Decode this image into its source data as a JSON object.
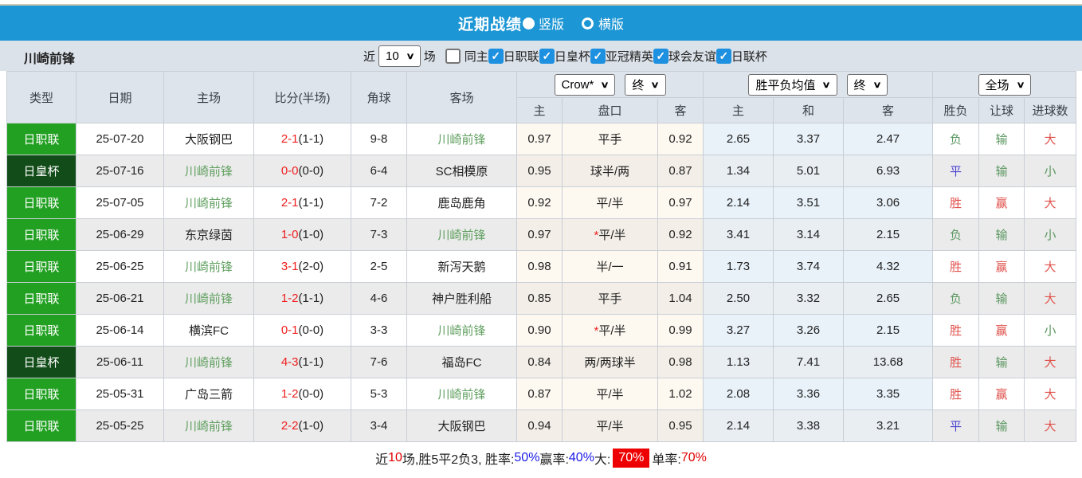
{
  "title_bar": {
    "title": "近期战绩",
    "radios": [
      {
        "label": "竖版",
        "selected": true
      },
      {
        "label": "横版",
        "selected": false
      }
    ]
  },
  "filter_bar": {
    "team": "川崎前锋",
    "near_label": "近",
    "near_value": "10",
    "games_label": "场",
    "checkboxes": [
      {
        "label": "同主",
        "checked": false
      },
      {
        "label": "日职联",
        "checked": true
      },
      {
        "label": "日皇杯",
        "checked": true
      },
      {
        "label": "亚冠精英",
        "checked": true
      },
      {
        "label": "球会友谊",
        "checked": true
      },
      {
        "label": "日联杯",
        "checked": true
      }
    ],
    "check_glyph": "✓"
  },
  "table": {
    "headers": [
      "类型",
      "日期",
      "主场",
      "比分(半场)",
      "角球",
      "客场"
    ],
    "sub_headers": [
      "主",
      "盘口",
      "客",
      "主",
      "和",
      "客",
      "胜负",
      "让球",
      "进球数"
    ],
    "selects": {
      "bookmaker": "Crow*",
      "bookmaker_time": "终",
      "odds_type": "胜平负均值",
      "odds_time": "终",
      "scope": "全场"
    },
    "arrow_glyph": "∨",
    "rows": [
      {
        "type": "日职联",
        "type_style": "league",
        "date": "25-07-20",
        "home": "大阪钢巴",
        "home_hl": false,
        "score": "2-1",
        "half": "(1-1)",
        "corner": "9-8",
        "away": "川崎前锋",
        "away_hl": true,
        "let_home": "0.97",
        "handicap": "平手",
        "handicap_star": false,
        "let_away": "0.92",
        "avg_home": "2.65",
        "avg_draw": "3.37",
        "avg_away": "2.47",
        "wdl": "负",
        "wdl_c": "green",
        "let_res": "输",
        "let_c": "green",
        "goals": "大",
        "goals_c": "red"
      },
      {
        "type": "日皇杯",
        "type_style": "cup",
        "date": "25-07-16",
        "home": "川崎前锋",
        "home_hl": true,
        "score": "0-0",
        "half": "(0-0)",
        "corner": "6-4",
        "away": "SC相模原",
        "away_hl": false,
        "let_home": "0.95",
        "handicap": "球半/两",
        "handicap_star": false,
        "let_away": "0.87",
        "avg_home": "1.34",
        "avg_draw": "5.01",
        "avg_away": "6.93",
        "wdl": "平",
        "wdl_c": "blue",
        "let_res": "输",
        "let_c": "green",
        "goals": "小",
        "goals_c": "green"
      },
      {
        "type": "日职联",
        "type_style": "league",
        "date": "25-07-05",
        "home": "川崎前锋",
        "home_hl": true,
        "score": "2-1",
        "half": "(1-1)",
        "corner": "7-2",
        "away": "鹿岛鹿角",
        "away_hl": false,
        "let_home": "0.92",
        "handicap": "平/半",
        "handicap_star": false,
        "let_away": "0.97",
        "avg_home": "2.14",
        "avg_draw": "3.51",
        "avg_away": "3.06",
        "wdl": "胜",
        "wdl_c": "red",
        "let_res": "赢",
        "let_c": "red",
        "goals": "大",
        "goals_c": "red"
      },
      {
        "type": "日职联",
        "type_style": "league",
        "date": "25-06-29",
        "home": "东京绿茵",
        "home_hl": false,
        "score": "1-0",
        "half": "(1-0)",
        "corner": "7-3",
        "away": "川崎前锋",
        "away_hl": true,
        "let_home": "0.97",
        "handicap": "平/半",
        "handicap_star": true,
        "let_away": "0.92",
        "avg_home": "3.41",
        "avg_draw": "3.14",
        "avg_away": "2.15",
        "wdl": "负",
        "wdl_c": "green",
        "let_res": "输",
        "let_c": "green",
        "goals": "小",
        "goals_c": "green"
      },
      {
        "type": "日职联",
        "type_style": "league",
        "date": "25-06-25",
        "home": "川崎前锋",
        "home_hl": true,
        "score": "3-1",
        "half": "(2-0)",
        "corner": "2-5",
        "away": "新泻天鹅",
        "away_hl": false,
        "let_home": "0.98",
        "handicap": "半/一",
        "handicap_star": false,
        "let_away": "0.91",
        "avg_home": "1.73",
        "avg_draw": "3.74",
        "avg_away": "4.32",
        "wdl": "胜",
        "wdl_c": "red",
        "let_res": "赢",
        "let_c": "red",
        "goals": "大",
        "goals_c": "red"
      },
      {
        "type": "日职联",
        "type_style": "league",
        "date": "25-06-21",
        "home": "川崎前锋",
        "home_hl": true,
        "score": "1-2",
        "half": "(1-1)",
        "corner": "4-6",
        "away": "神户胜利船",
        "away_hl": false,
        "let_home": "0.85",
        "handicap": "平手",
        "handicap_star": false,
        "let_away": "1.04",
        "avg_home": "2.50",
        "avg_draw": "3.32",
        "avg_away": "2.65",
        "wdl": "负",
        "wdl_c": "green",
        "let_res": "输",
        "let_c": "green",
        "goals": "大",
        "goals_c": "red"
      },
      {
        "type": "日职联",
        "type_style": "league",
        "date": "25-06-14",
        "home": "横滨FC",
        "home_hl": false,
        "score": "0-1",
        "half": "(0-0)",
        "corner": "3-3",
        "away": "川崎前锋",
        "away_hl": true,
        "let_home": "0.90",
        "handicap": "平/半",
        "handicap_star": true,
        "let_away": "0.99",
        "avg_home": "3.27",
        "avg_draw": "3.26",
        "avg_away": "2.15",
        "wdl": "胜",
        "wdl_c": "red",
        "let_res": "赢",
        "let_c": "red",
        "goals": "小",
        "goals_c": "green"
      },
      {
        "type": "日皇杯",
        "type_style": "cup",
        "date": "25-06-11",
        "home": "川崎前锋",
        "home_hl": true,
        "score": "4-3",
        "half": "(1-1)",
        "corner": "7-6",
        "away": "福岛FC",
        "away_hl": false,
        "let_home": "0.84",
        "handicap": "两/两球半",
        "handicap_star": false,
        "let_away": "0.98",
        "avg_home": "1.13",
        "avg_draw": "7.41",
        "avg_away": "13.68",
        "wdl": "胜",
        "wdl_c": "red",
        "let_res": "输",
        "let_c": "green",
        "goals": "大",
        "goals_c": "red"
      },
      {
        "type": "日职联",
        "type_style": "league",
        "date": "25-05-31",
        "home": "广岛三箭",
        "home_hl": false,
        "score": "1-2",
        "half": "(0-0)",
        "corner": "5-3",
        "away": "川崎前锋",
        "away_hl": true,
        "let_home": "0.87",
        "handicap": "平/半",
        "handicap_star": false,
        "let_away": "1.02",
        "avg_home": "2.08",
        "avg_draw": "3.36",
        "avg_away": "3.35",
        "wdl": "胜",
        "wdl_c": "red",
        "let_res": "赢",
        "let_c": "red",
        "goals": "大",
        "goals_c": "red"
      },
      {
        "type": "日职联",
        "type_style": "league",
        "date": "25-05-25",
        "home": "川崎前锋",
        "home_hl": true,
        "score": "2-2",
        "half": "(1-0)",
        "corner": "3-4",
        "away": "大阪钢巴",
        "away_hl": false,
        "let_home": "0.94",
        "handicap": "平/半",
        "handicap_star": false,
        "let_away": "0.95",
        "avg_home": "2.14",
        "avg_draw": "3.38",
        "avg_away": "3.21",
        "wdl": "平",
        "wdl_c": "blue",
        "let_res": "输",
        "let_c": "green",
        "goals": "大",
        "goals_c": "red"
      }
    ]
  },
  "summary": {
    "segments": [
      {
        "text": "近",
        "style": "plain"
      },
      {
        "text": "10",
        "style": "red"
      },
      {
        "text": "场,胜5平2负3, 胜率:",
        "style": "plain"
      },
      {
        "text": "50%",
        "style": "blue"
      },
      {
        "text": " 赢率:",
        "style": "plain"
      },
      {
        "text": "40%",
        "style": "blue"
      },
      {
        "text": " 大:",
        "style": "plain"
      },
      {
        "text": "70%",
        "style": "badge"
      },
      {
        "text": " 单率:",
        "style": "plain"
      },
      {
        "text": "70%",
        "style": "red"
      }
    ]
  },
  "colors": {
    "header_blue": "#1c96d4",
    "filter_bar": "#dce2ea",
    "league_green": "#22a022",
    "cup_dark_green": "#124c18",
    "team_highlight": "#61a061",
    "score_red": "#f01e1e",
    "result_red": "#e0524c",
    "result_blue": "#4a43cf",
    "result_green": "#5b9760",
    "checkbox_blue": "#1e90e0",
    "summary_badge_red": "#ee0000",
    "summary_blue": "#1a1ae8"
  }
}
